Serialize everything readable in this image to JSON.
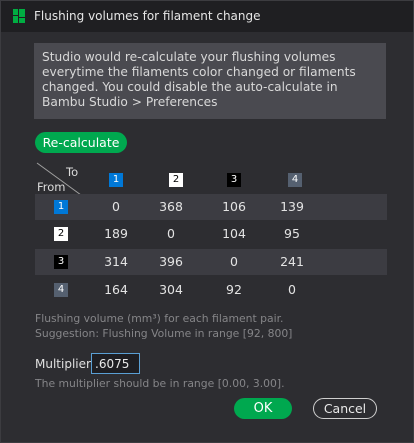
{
  "window": {
    "title": "Flushing volumes for filament change",
    "icon": "bambu-studio-logo-icon"
  },
  "info": {
    "text": "Studio would re-calculate your flushing volumes everytime the filaments color changed or filaments changed. You could disable the auto-calculate in Bambu Studio > Preferences"
  },
  "recalculate_label": "Re-calculate",
  "table": {
    "header_to": "To",
    "header_from": "From",
    "columns": [
      {
        "label": "1",
        "bg": "#0078d7",
        "fg": "#ffffff"
      },
      {
        "label": "2",
        "bg": "#ffffff",
        "fg": "#000000"
      },
      {
        "label": "3",
        "bg": "#000000",
        "fg": "#ffffff"
      },
      {
        "label": "4",
        "bg": "#556070",
        "fg": "#ffffff"
      }
    ],
    "rows": [
      {
        "label": "1",
        "bg": "#0078d7",
        "fg": "#ffffff",
        "values": [
          "0",
          "368",
          "106",
          "139"
        ]
      },
      {
        "label": "2",
        "bg": "#ffffff",
        "fg": "#000000",
        "values": [
          "189",
          "0",
          "104",
          "95"
        ]
      },
      {
        "label": "3",
        "bg": "#000000",
        "fg": "#ffffff",
        "values": [
          "314",
          "396",
          "0",
          "241"
        ]
      },
      {
        "label": "4",
        "bg": "#556070",
        "fg": "#ffffff",
        "values": [
          "164",
          "304",
          "92",
          "0"
        ]
      }
    ]
  },
  "notes": {
    "unit": "Flushing volume (mm³) for each filament pair.",
    "suggestion": "Suggestion: Flushing Volume in range [92, 800]"
  },
  "multiplier": {
    "label": "Multiplier",
    "value": ".6075",
    "range_note": "The multiplier should be in range [0.00, 3.00]."
  },
  "buttons": {
    "ok": "OK",
    "cancel": "Cancel"
  },
  "colors": {
    "accent": "#00a84f",
    "window_bg": "#2d2d31",
    "titlebar_bg": "#1f1f22"
  }
}
